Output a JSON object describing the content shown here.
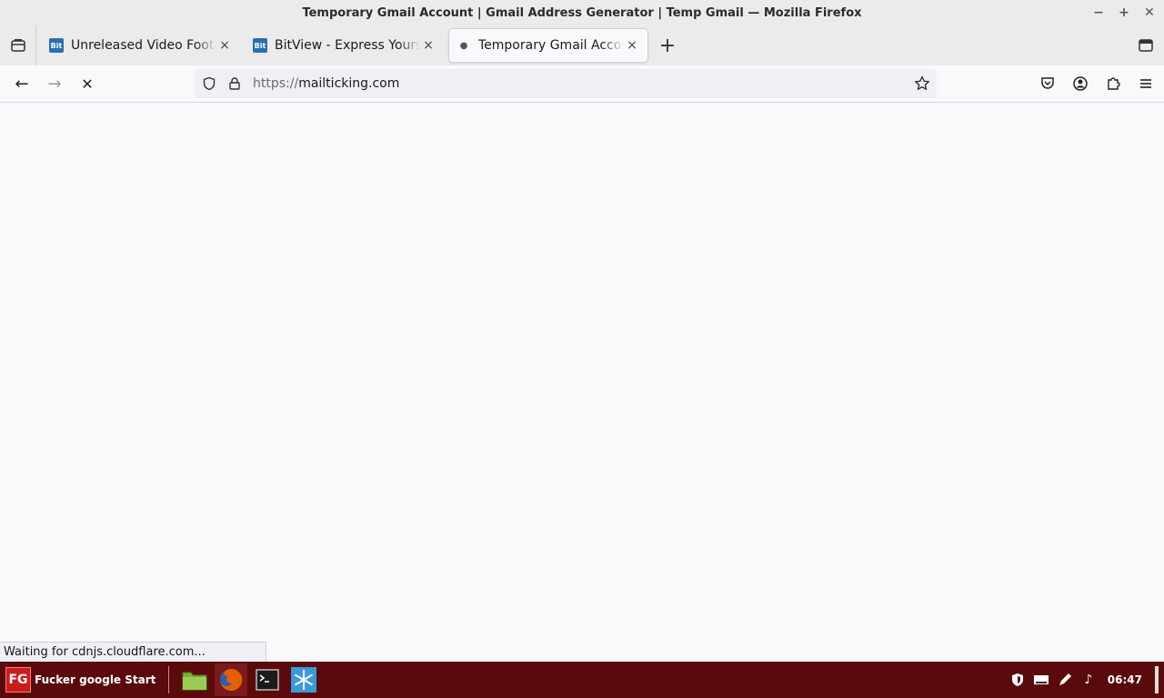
{
  "window": {
    "title": "Temporary Gmail Account | Gmail Address Generator | Temp Gmail — Mozilla Firefox",
    "minimize_glyph": "−",
    "maximize_glyph": "+",
    "close_glyph": "✕"
  },
  "tabs": [
    {
      "title": "Unreleased Video Footage",
      "favicon": "Bit",
      "active": false,
      "loading": false
    },
    {
      "title": "BitView - Express Yourself",
      "favicon": "Bit",
      "active": false,
      "loading": false
    },
    {
      "title": "Temporary Gmail Account",
      "favicon": "",
      "active": true,
      "loading": true
    }
  ],
  "tab_close_glyph": "×",
  "newtab_glyph": "+",
  "nav": {
    "back_glyph": "←",
    "forward_glyph": "→",
    "stop_glyph": "✕"
  },
  "url": {
    "scheme": "https://",
    "host": "mailticking.com"
  },
  "status": {
    "text": "Waiting for cdnjs.cloudflare.com..."
  },
  "taskbar": {
    "start_logo": "FG",
    "start_label": "Fucker google Start",
    "clock": "06:47"
  },
  "icons": [
    "firefox-view-icon",
    "tab-favicon-bitview",
    "loading-dot-icon",
    "list-all-tabs-icon",
    "back-arrow-icon",
    "forward-arrow-icon",
    "stop-icon",
    "shield-icon",
    "lock-icon",
    "star-icon",
    "pocket-icon",
    "account-icon",
    "extensions-icon",
    "menu-icon",
    "file-manager-icon",
    "firefox-icon",
    "terminal-icon",
    "snowflake-app-icon",
    "security-shield-icon",
    "keyboard-icon",
    "pen-icon",
    "music-note-icon"
  ],
  "colors": {
    "taskbar": "#5a0a0a",
    "start_logo": "#c81d1d",
    "page_bg": "#f9f9fb"
  }
}
